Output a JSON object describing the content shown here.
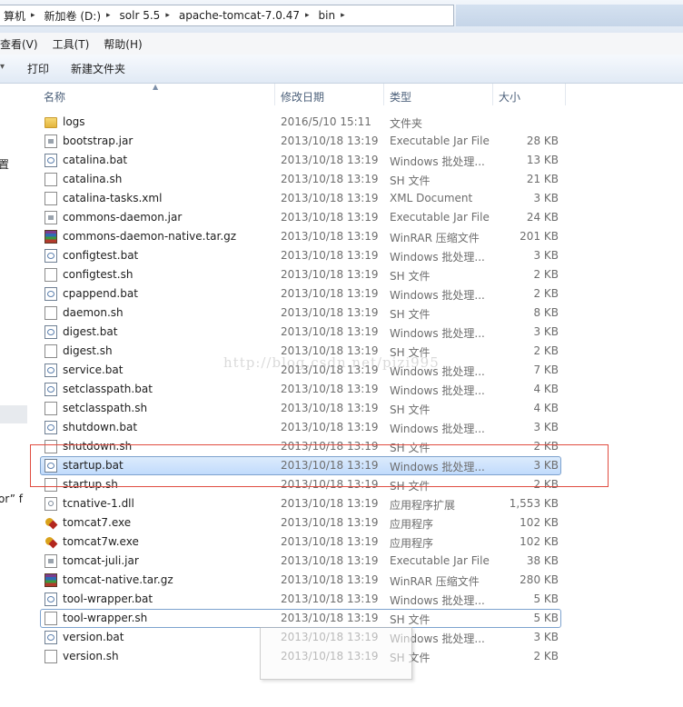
{
  "address": {
    "crumbs": [
      "算机",
      "新加卷 (D:)",
      "solr 5.5",
      "apache-tomcat-7.0.47",
      "bin"
    ]
  },
  "menu": [
    "查看(V)",
    "工具(T)",
    "帮助(H)"
  ],
  "toolbar": {
    "print": "打印",
    "new_folder": "新建文件夹"
  },
  "nav": {
    "frag1": "置",
    "frag2": "or” f"
  },
  "columns": {
    "name": "名称",
    "date": "修改日期",
    "type": "类型",
    "size": "大小"
  },
  "files": [
    {
      "name": "logs",
      "date": "2016/5/10 15:11",
      "type": "文件夹",
      "size": "",
      "icon": "folder-icon"
    },
    {
      "name": "bootstrap.jar",
      "date": "2013/10/18 13:19",
      "type": "Executable Jar File",
      "size": "28 KB",
      "icon": "jar-file-icon"
    },
    {
      "name": "catalina.bat",
      "date": "2013/10/18 13:19",
      "type": "Windows 批处理...",
      "size": "13 KB",
      "icon": "batch-file-icon"
    },
    {
      "name": "catalina.sh",
      "date": "2013/10/18 13:19",
      "type": "SH 文件",
      "size": "21 KB",
      "icon": "document-icon"
    },
    {
      "name": "catalina-tasks.xml",
      "date": "2013/10/18 13:19",
      "type": "XML Document",
      "size": "3 KB",
      "icon": "document-icon"
    },
    {
      "name": "commons-daemon.jar",
      "date": "2013/10/18 13:19",
      "type": "Executable Jar File",
      "size": "24 KB",
      "icon": "jar-file-icon"
    },
    {
      "name": "commons-daemon-native.tar.gz",
      "date": "2013/10/18 13:19",
      "type": "WinRAR 压缩文件",
      "size": "201 KB",
      "icon": "archive-icon"
    },
    {
      "name": "configtest.bat",
      "date": "2013/10/18 13:19",
      "type": "Windows 批处理...",
      "size": "3 KB",
      "icon": "batch-file-icon"
    },
    {
      "name": "configtest.sh",
      "date": "2013/10/18 13:19",
      "type": "SH 文件",
      "size": "2 KB",
      "icon": "document-icon"
    },
    {
      "name": "cpappend.bat",
      "date": "2013/10/18 13:19",
      "type": "Windows 批处理...",
      "size": "2 KB",
      "icon": "batch-file-icon"
    },
    {
      "name": "daemon.sh",
      "date": "2013/10/18 13:19",
      "type": "SH 文件",
      "size": "8 KB",
      "icon": "document-icon"
    },
    {
      "name": "digest.bat",
      "date": "2013/10/18 13:19",
      "type": "Windows 批处理...",
      "size": "3 KB",
      "icon": "batch-file-icon"
    },
    {
      "name": "digest.sh",
      "date": "2013/10/18 13:19",
      "type": "SH 文件",
      "size": "2 KB",
      "icon": "document-icon"
    },
    {
      "name": "service.bat",
      "date": "2013/10/18 13:19",
      "type": "Windows 批处理...",
      "size": "7 KB",
      "icon": "batch-file-icon"
    },
    {
      "name": "setclasspath.bat",
      "date": "2013/10/18 13:19",
      "type": "Windows 批处理...",
      "size": "4 KB",
      "icon": "batch-file-icon"
    },
    {
      "name": "setclasspath.sh",
      "date": "2013/10/18 13:19",
      "type": "SH 文件",
      "size": "4 KB",
      "icon": "document-icon"
    },
    {
      "name": "shutdown.bat",
      "date": "2013/10/18 13:19",
      "type": "Windows 批处理...",
      "size": "3 KB",
      "icon": "batch-file-icon"
    },
    {
      "name": "shutdown.sh",
      "date": "2013/10/18 13:19",
      "type": "SH 文件",
      "size": "2 KB",
      "icon": "document-icon"
    },
    {
      "name": "startup.bat",
      "date": "2013/10/18 13:19",
      "type": "Windows 批处理...",
      "size": "3 KB",
      "icon": "batch-file-icon",
      "selected": true
    },
    {
      "name": "startup.sh",
      "date": "2013/10/18 13:19",
      "type": "SH 文件",
      "size": "2 KB",
      "icon": "document-icon"
    },
    {
      "name": "tcnative-1.dll",
      "date": "2013/10/18 13:19",
      "type": "应用程序扩展",
      "size": "1,553 KB",
      "icon": "dll-file-icon"
    },
    {
      "name": "tomcat7.exe",
      "date": "2013/10/18 13:19",
      "type": "应用程序",
      "size": "102 KB",
      "icon": "tomcat-exe-icon"
    },
    {
      "name": "tomcat7w.exe",
      "date": "2013/10/18 13:19",
      "type": "应用程序",
      "size": "102 KB",
      "icon": "tomcat-exe-icon"
    },
    {
      "name": "tomcat-juli.jar",
      "date": "2013/10/18 13:19",
      "type": "Executable Jar File",
      "size": "38 KB",
      "icon": "jar-file-icon"
    },
    {
      "name": "tomcat-native.tar.gz",
      "date": "2013/10/18 13:19",
      "type": "WinRAR 压缩文件",
      "size": "280 KB",
      "icon": "archive-icon"
    },
    {
      "name": "tool-wrapper.bat",
      "date": "2013/10/18 13:19",
      "type": "Windows 批处理...",
      "size": "5 KB",
      "icon": "batch-file-icon"
    },
    {
      "name": "tool-wrapper.sh",
      "date": "2013/10/18 13:19",
      "type": "SH 文件",
      "size": "5 KB",
      "icon": "document-icon",
      "focused": true
    },
    {
      "name": "version.bat",
      "date": "2013/10/18 13:19",
      "type": "Windows 批处理...",
      "size": "3 KB",
      "icon": "batch-file-icon"
    },
    {
      "name": "version.sh",
      "date": "2013/10/18 13:19",
      "type": "SH 文件",
      "size": "2 KB",
      "icon": "document-icon"
    }
  ],
  "watermark": "http://blog.csdn.net/pizi995",
  "colors": {
    "selection": "#cce4fc",
    "annotation_red": "#e04c40",
    "header_text": "#4c607a"
  }
}
